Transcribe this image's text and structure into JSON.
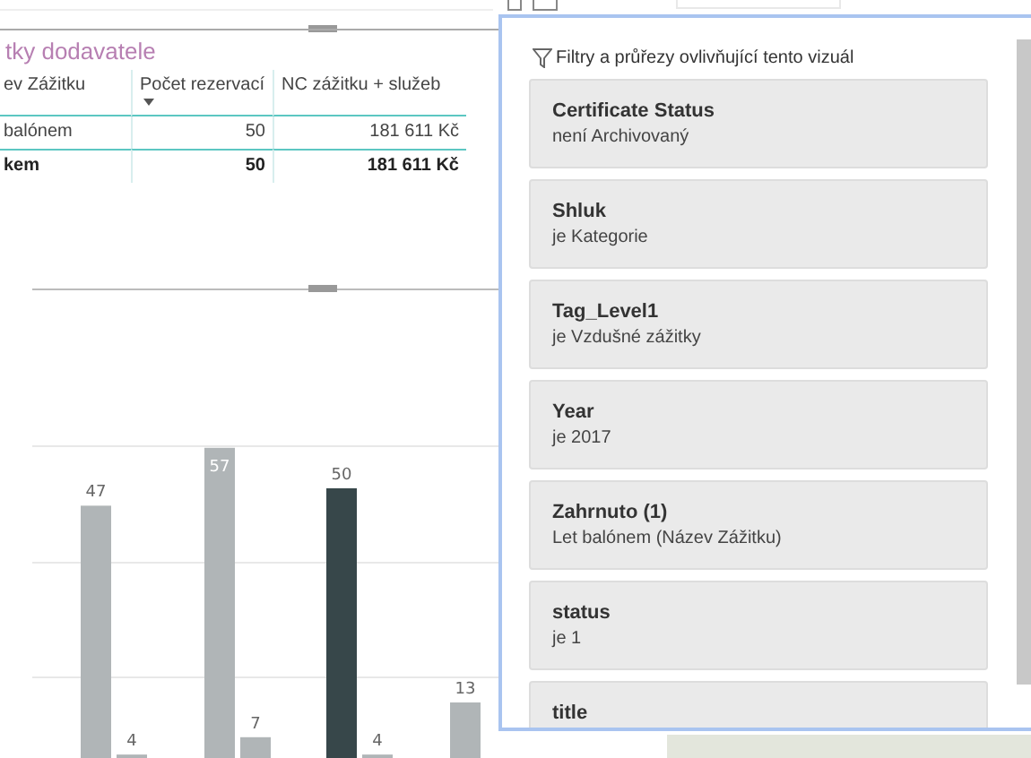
{
  "table": {
    "title": "tky dodavatele",
    "columns": [
      {
        "label": "ev Zážitku",
        "sorted": false
      },
      {
        "label": "Počet rezervací",
        "sorted": true
      },
      {
        "label": "NC zážitku + služeb",
        "sorted": false
      }
    ],
    "rows": [
      {
        "kind": "data",
        "cells": [
          "balónem",
          "50",
          "181 611 Kč"
        ]
      },
      {
        "kind": "total",
        "cells": [
          "kem",
          "50",
          "181 611 Kč"
        ]
      }
    ]
  },
  "chart": {
    "bar_groups": [
      {
        "highlighted": false,
        "labels": [
          "47",
          "4"
        ]
      },
      {
        "highlighted": false,
        "labels": [
          "57",
          "7"
        ]
      },
      {
        "highlighted": true,
        "labels": [
          "50",
          "4"
        ]
      },
      {
        "highlighted": false,
        "labels": [
          "13"
        ]
      }
    ]
  },
  "filters_popup": {
    "heading": "Filtry a průřezy ovlivňující tento vizuál",
    "filters": [
      {
        "field": "Certificate Status",
        "condition": "není Archivovaný"
      },
      {
        "field": "Shluk",
        "condition": "je Kategorie"
      },
      {
        "field": "Tag_Level1",
        "condition": "je Vzdušné zážitky"
      },
      {
        "field": "Year",
        "condition": "je 2017"
      },
      {
        "field": "Zahrnuto (1)",
        "condition": "Let balónem (Název Zážitku)"
      },
      {
        "field": "status",
        "condition": "je 1"
      },
      {
        "field": "title"
      }
    ]
  }
}
